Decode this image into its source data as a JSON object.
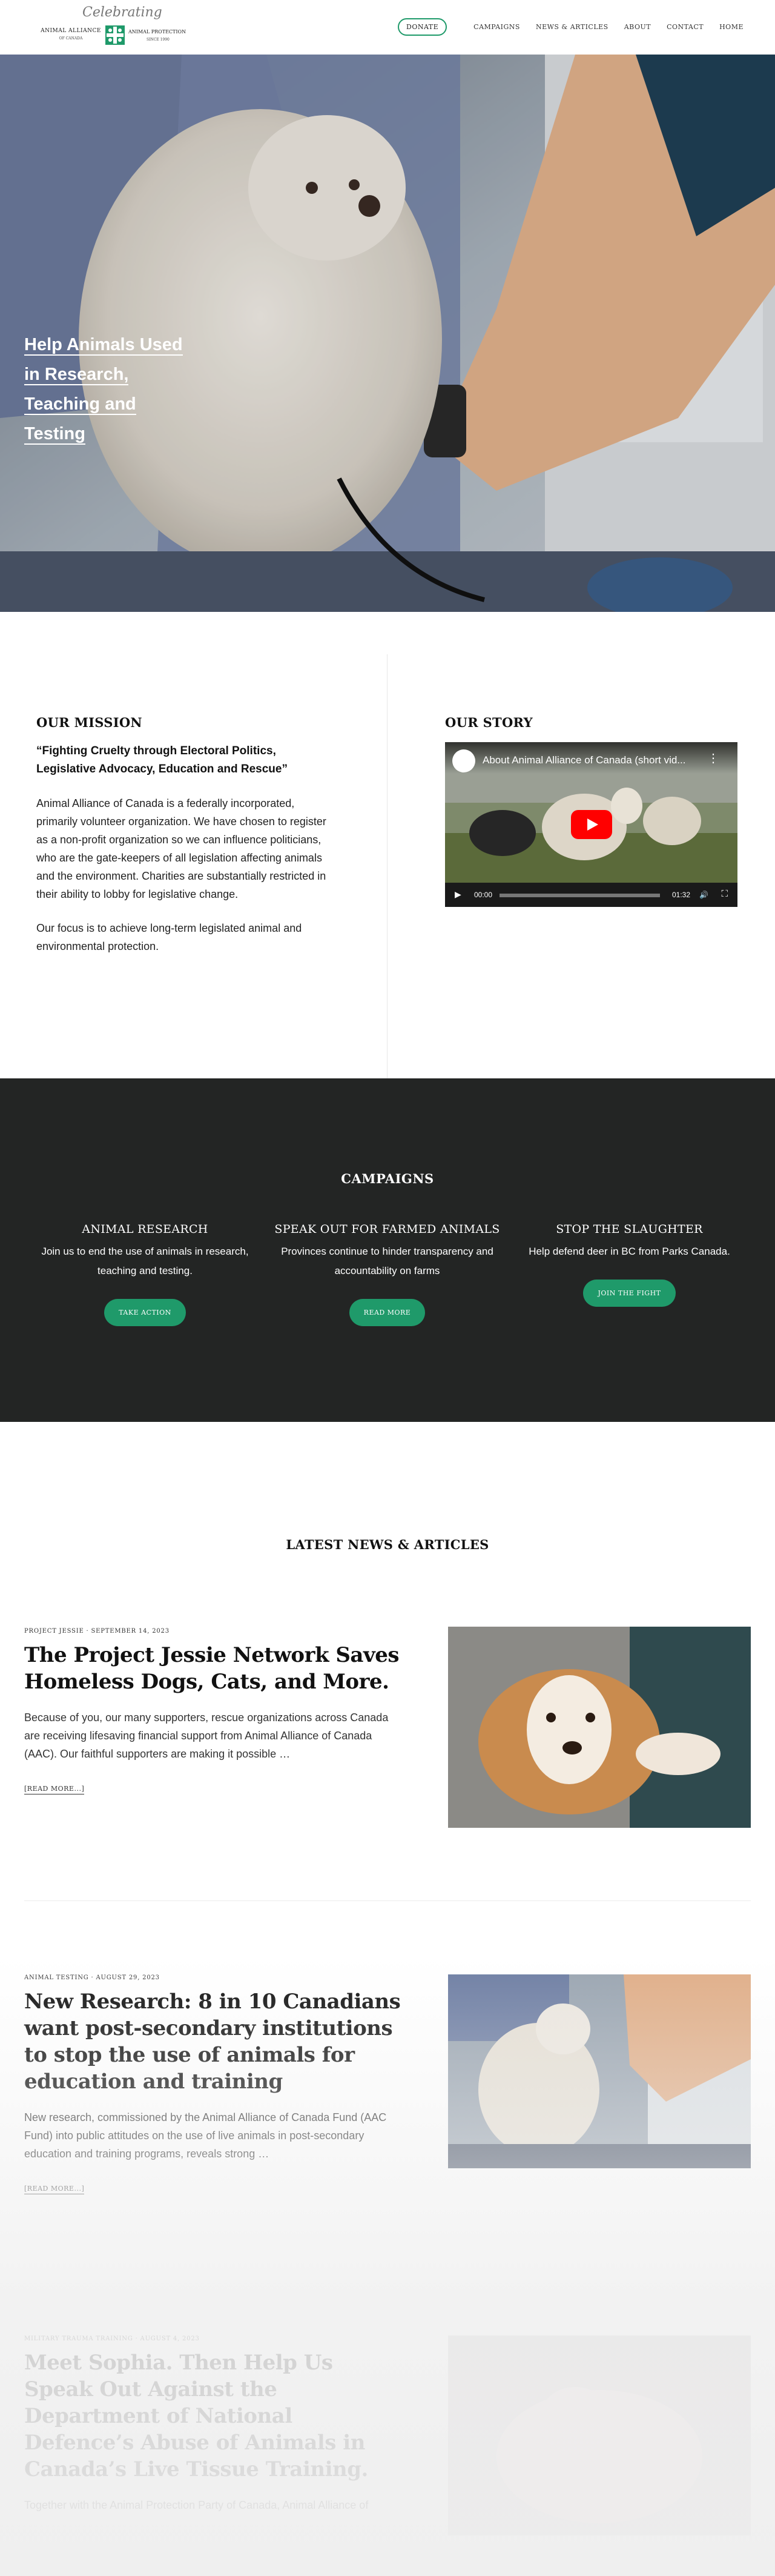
{
  "header": {
    "logo": {
      "celebrating": "Celebrating",
      "aa_name": "ANIMAL ALLIANCE",
      "aa_sub": "OF CANADA",
      "ap_name": "ANIMAL PROTECTION",
      "ap_sub": "SINCE 1990"
    },
    "nav": {
      "donate": "DONATE",
      "items": [
        "CAMPAIGNS",
        "NEWS & ARTICLES",
        "ABOUT",
        "CONTACT",
        "HOME"
      ]
    }
  },
  "hero": {
    "title": "Help Animals Used in Research, Teaching and Testing"
  },
  "mission": {
    "heading": "OUR MISSION",
    "quote": "“Fighting Cruelty through Electoral Politics, Legislative Advocacy, Education and Rescue”",
    "paragraph1": "Animal Alliance of Canada is a federally incorporated, primarily volunteer organization. We have chosen to register as a non-profit organization so we can influence politicians, who are the gate-keepers of all legislation affecting animals and the environment. Charities are substantially restricted in their ability to lobby for legislative change.",
    "paragraph2": "Our focus is to achieve long-term legislated animal and environmental protection."
  },
  "story": {
    "heading": "OUR STORY",
    "video_title": "About Animal Alliance of Canada (short vid...",
    "time_current": "00:00",
    "time_total": "01:32"
  },
  "campaigns": {
    "heading": "CAMPAIGNS",
    "items": [
      {
        "title": "ANIMAL RESEARCH",
        "text": "Join us to end the use of animals in research, teaching and testing.",
        "button": "TAKE ACTION"
      },
      {
        "title": "SPEAK OUT FOR FARMED ANIMALS",
        "text": "Provinces continue to hinder transparency and accountability on farms",
        "button": "READ MORE"
      },
      {
        "title": "STOP THE SLAUGHTER",
        "text": "Help defend deer in BC from Parks Canada.",
        "button": "JOIN THE FIGHT"
      }
    ]
  },
  "news": {
    "heading": "LATEST NEWS & ARTICLES",
    "articles": [
      {
        "meta": "PROJECT JESSIE · SEPTEMBER 14, 2023",
        "title": "The Project Jessie Network Saves Homeless Dogs, Cats, and More.",
        "excerpt": "Because of you, our many supporters, rescue organizations across Canada are receiving lifesaving financial support from Animal Alliance of Canada (AAC). Our faithful supporters are making it possible …",
        "more": "[READ MORE...]"
      },
      {
        "meta": "ANIMAL TESTING · AUGUST 29, 2023",
        "title": "New Research: 8 in 10 Canadians want post-secondary institutions to stop the use of animals for education and training",
        "excerpt": "New research, commissioned by the Animal Alliance of Canada Fund (AAC Fund) into public attitudes on the use of live animals in post-secondary education and training programs, reveals strong …",
        "more": "[READ MORE...]"
      },
      {
        "meta": "MILITARY TRAUMA TRAINING · AUGUST 4, 2023",
        "title": "Meet Sophia. Then Help Us Speak Out Against the Department of National Defence’s Abuse of Animals in Canada’s Live Tissue Training.",
        "excerpt": "Together with the Animal Protection Party of Canada, Animal Alliance of"
      }
    ]
  }
}
